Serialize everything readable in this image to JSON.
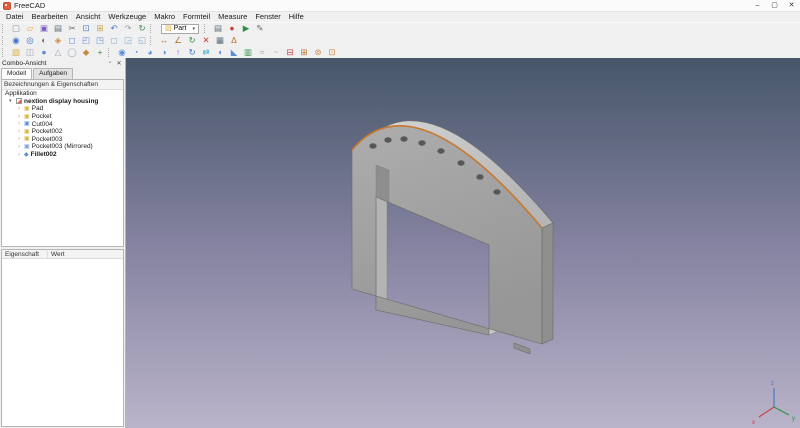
{
  "window": {
    "title": "FreeCAD",
    "minimize_glyph": "–",
    "maximize_glyph": "▢",
    "close_glyph": "✕"
  },
  "menubar": {
    "items": [
      "Datei",
      "Bearbeiten",
      "Ansicht",
      "Werkzeuge",
      "Makro",
      "Formteil",
      "Measure",
      "Fenster",
      "Hilfe"
    ]
  },
  "toolbars": {
    "file": [
      {
        "name": "new-file-icon",
        "glyph": "▢",
        "color": "#8a9099"
      },
      {
        "name": "open-file-icon",
        "glyph": "▱",
        "color": "#e8a33d"
      },
      {
        "name": "save-icon",
        "glyph": "▣",
        "color": "#7d5fc4"
      },
      {
        "name": "print-icon",
        "glyph": "▤",
        "color": "#5f6b76"
      },
      {
        "name": "cut-icon",
        "glyph": "✂",
        "color": "#5f6b76"
      },
      {
        "name": "copy-icon",
        "glyph": "⊡",
        "color": "#4a7fc9"
      },
      {
        "name": "paste-icon",
        "glyph": "⊞",
        "color": "#c9a23f"
      },
      {
        "name": "undo-icon",
        "glyph": "↶",
        "color": "#3f74c9"
      },
      {
        "name": "redo-icon",
        "glyph": "↷",
        "color": "#9aa0a6"
      },
      {
        "name": "refresh-icon",
        "glyph": "↻",
        "color": "#2f8f46"
      }
    ],
    "workbench": {
      "selected": "Part",
      "icon_glyph": "▧",
      "caret": "▾"
    },
    "macro": [
      {
        "name": "macro-dialog-icon",
        "glyph": "▤",
        "color": "#5f6b76"
      },
      {
        "name": "macro-record-icon",
        "glyph": "●",
        "color": "#cc3b3b"
      },
      {
        "name": "macro-execute-icon",
        "glyph": "▶",
        "color": "#2f8f46"
      },
      {
        "name": "macro-edit-icon",
        "glyph": "✎",
        "color": "#5f6b76"
      }
    ],
    "view": [
      {
        "name": "fit-all-icon",
        "glyph": "◉",
        "color": "#3f74c9"
      },
      {
        "name": "fit-selection-icon",
        "glyph": "◎",
        "color": "#3f74c9"
      },
      {
        "name": "draw-style-icon",
        "glyph": "◐",
        "color": "#5f6b76"
      },
      {
        "name": "view-isometric-icon",
        "glyph": "◈",
        "color": "#c98a3f"
      },
      {
        "name": "view-front-icon",
        "glyph": "◻",
        "color": "#5b8dd9"
      },
      {
        "name": "view-top-icon",
        "glyph": "◰",
        "color": "#5b8dd9"
      },
      {
        "name": "view-right-icon",
        "glyph": "◳",
        "color": "#5b8dd9"
      },
      {
        "name": "view-rear-icon",
        "glyph": "◻",
        "color": "#86a8d9"
      },
      {
        "name": "view-bottom-icon",
        "glyph": "◲",
        "color": "#86a8d9"
      },
      {
        "name": "view-left-icon",
        "glyph": "◱",
        "color": "#86a8d9"
      }
    ],
    "measure": [
      {
        "name": "measure-linear-icon",
        "glyph": "↔",
        "color": "#b5732f"
      },
      {
        "name": "measure-angular-icon",
        "glyph": "∠",
        "color": "#b5732f"
      },
      {
        "name": "measure-refresh-icon",
        "glyph": "↻",
        "color": "#2f8f46"
      },
      {
        "name": "measure-clear-icon",
        "glyph": "✕",
        "color": "#cc3b3b"
      },
      {
        "name": "measure-toggle-3d-icon",
        "glyph": "▦",
        "color": "#5f6b76"
      },
      {
        "name": "measure-toggle-delta-icon",
        "glyph": "Δ",
        "color": "#b5732f"
      }
    ],
    "part_primitives": [
      {
        "name": "part-box-icon",
        "glyph": "▧",
        "color": "#ddb13c"
      },
      {
        "name": "part-cylinder-icon",
        "glyph": "◫",
        "color": "#97a6b4"
      },
      {
        "name": "part-sphere-icon",
        "glyph": "●",
        "color": "#5b8dd9"
      },
      {
        "name": "part-cone-icon",
        "glyph": "△",
        "color": "#97a6b4"
      },
      {
        "name": "part-torus-icon",
        "glyph": "◯",
        "color": "#97a6b4"
      },
      {
        "name": "part-primitives-icon",
        "glyph": "◆",
        "color": "#c98a3f"
      },
      {
        "name": "shape-builder-icon",
        "glyph": "+",
        "color": "#2f8f46"
      }
    ],
    "part_tools": [
      {
        "name": "boolean-icon",
        "glyph": "◉",
        "color": "#5b8dd9"
      },
      {
        "name": "boolean-cut-icon",
        "glyph": "◔",
        "color": "#5b8dd9"
      },
      {
        "name": "boolean-union-icon",
        "glyph": "◕",
        "color": "#5b8dd9"
      },
      {
        "name": "boolean-intersection-icon",
        "glyph": "◑",
        "color": "#5b8dd9"
      },
      {
        "name": "extrude-icon",
        "glyph": "↑",
        "color": "#8e5bd9"
      },
      {
        "name": "revolve-icon",
        "glyph": "↻",
        "color": "#3f74c9"
      },
      {
        "name": "mirror-icon",
        "glyph": "⇄",
        "color": "#49b6c4"
      },
      {
        "name": "fillet-icon",
        "glyph": "◖",
        "color": "#5b8dd9"
      },
      {
        "name": "chamfer-icon",
        "glyph": "◣",
        "color": "#5b8dd9"
      },
      {
        "name": "ruled-surface-icon",
        "glyph": "▥",
        "color": "#2f8f46"
      },
      {
        "name": "loft-icon",
        "glyph": "≈",
        "color": "#97a6b4"
      },
      {
        "name": "sweep-icon",
        "glyph": "~",
        "color": "#97a6b4"
      },
      {
        "name": "section-icon",
        "glyph": "⊟",
        "color": "#cc3b3b"
      },
      {
        "name": "cross-sections-icon",
        "glyph": "⊞",
        "color": "#b5732f"
      },
      {
        "name": "offset-icon",
        "glyph": "⊚",
        "color": "#c98a3f"
      },
      {
        "name": "thickness-icon",
        "glyph": "⊡",
        "color": "#c98a3f"
      }
    ]
  },
  "combo_view": {
    "title": "Combo-Ansicht",
    "float_glyph": "▫",
    "close_glyph": "✕",
    "tabs": {
      "model": "Modell",
      "tasks": "Aufgaben"
    },
    "tree_header": "Bezeichnungen & Eigenschaften",
    "root_label": "Applikation",
    "doc_expander": "▾",
    "document_label": "nextion display housing",
    "children": [
      {
        "chevron": "›",
        "glyph": "▣",
        "color": "#d9b23f",
        "label": "Pad",
        "weight": "400"
      },
      {
        "chevron": "›",
        "glyph": "▣",
        "color": "#d9b23f",
        "label": "Pocket",
        "weight": "400"
      },
      {
        "chevron": "›",
        "glyph": "▣",
        "color": "#5b8dd9",
        "label": "Cut004",
        "weight": "400"
      },
      {
        "chevron": "›",
        "glyph": "▣",
        "color": "#d9b23f",
        "label": "Pocket002",
        "weight": "400"
      },
      {
        "chevron": "›",
        "glyph": "▣",
        "color": "#d9b23f",
        "label": "Pocket003",
        "weight": "400"
      },
      {
        "chevron": "›",
        "glyph": "▣",
        "color": "#7a9fd9",
        "label": "Pocket003 (Mirrored)",
        "weight": "400"
      },
      {
        "chevron": "›",
        "glyph": "◆",
        "color": "#5b8dd9",
        "label": "Fillet002",
        "weight": "700"
      }
    ]
  },
  "properties": {
    "columns": [
      "Eigenschaft",
      "Wert"
    ]
  },
  "viewport": {
    "gradient": {
      "top": "#465669",
      "middle": "#8482a0",
      "bottom": "#bab4ca"
    },
    "model": {
      "face_light": "#adadad",
      "face_dark": "#969696",
      "band_light": "#d8d8d8",
      "band_dark": "#b6b6b6",
      "side": "#8f8f8f",
      "inner_left": "#b4b4b4",
      "inner_bottom": "#c6c6c6",
      "recess": "#8e8e8e",
      "hole": "#575757",
      "highlight": "#c8772e"
    },
    "axes": {
      "x": {
        "label": "x",
        "color": "#cc3b3b"
      },
      "y": {
        "label": "y",
        "color": "#2f8f46"
      },
      "z": {
        "label": "z",
        "color": "#3f74c9"
      }
    }
  }
}
